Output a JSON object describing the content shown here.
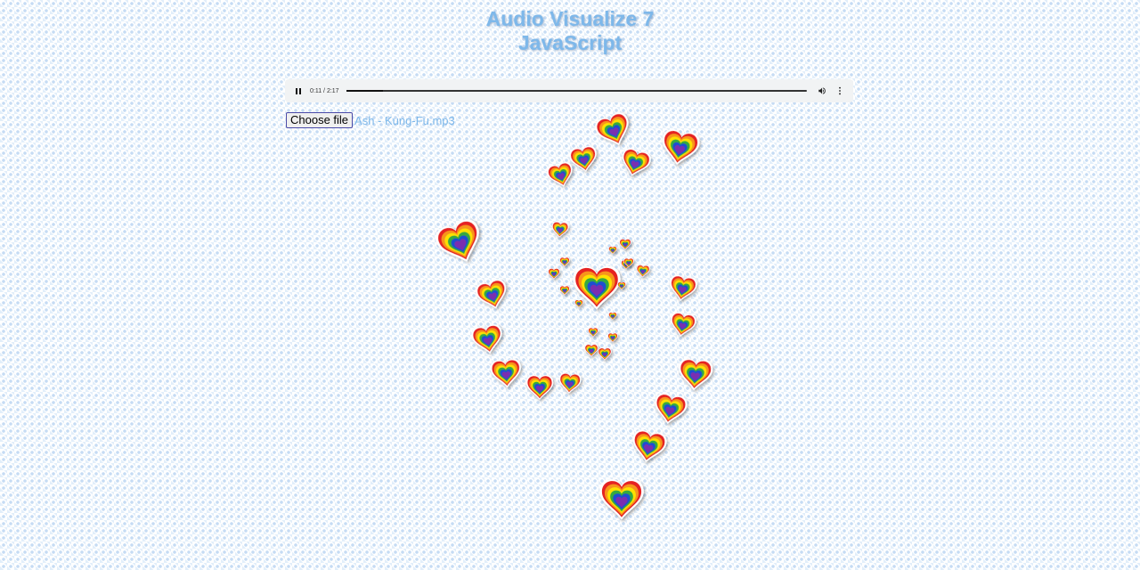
{
  "header": {
    "title_line1": "Audio Visualize 7",
    "title_line2": "JavaScript"
  },
  "player": {
    "current_time": "0:11",
    "duration": "2:17",
    "time_display": "0:11 / 2:17",
    "progress_fraction": 0.08,
    "state": "playing",
    "play_pause_icon": "pause-icon",
    "volume_icon": "volume-icon",
    "menu_icon": "more-vertical-icon"
  },
  "file_input": {
    "button_label": "Choose file",
    "file_name": "Ash - Kung-Fu.mp3"
  },
  "colors": {
    "title": "#7eb8ea",
    "heart_rings": [
      "#e52420",
      "#f7941d",
      "#fde100",
      "#36a93f",
      "#1f4fd0",
      "#7a2fb0"
    ]
  }
}
